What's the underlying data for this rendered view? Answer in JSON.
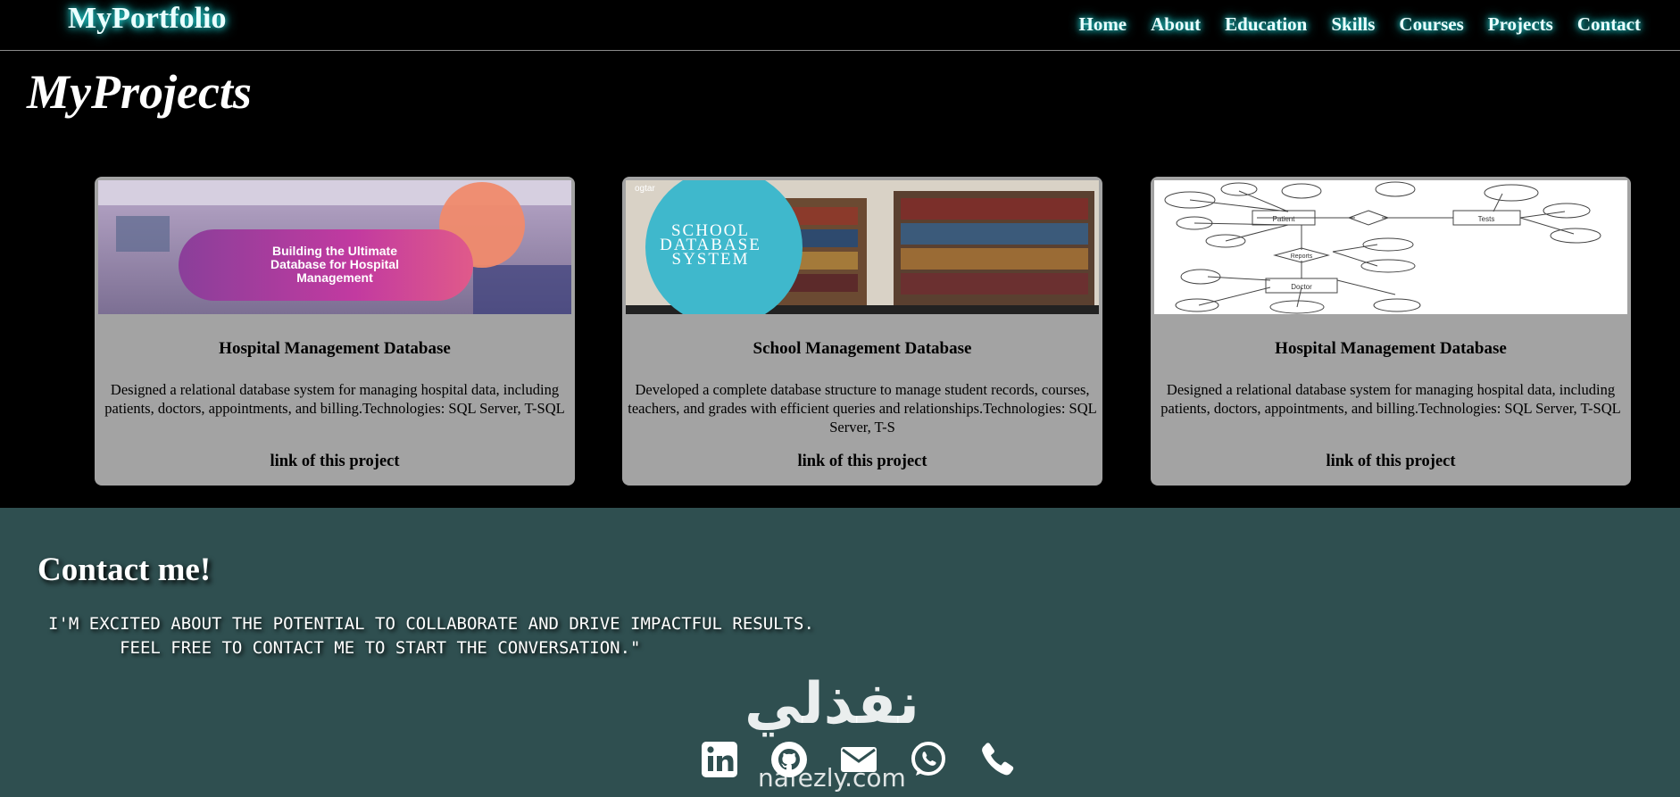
{
  "brand": "MyPortfolio",
  "nav": [
    "Home",
    "About",
    "Education",
    "Skills",
    "Courses",
    "Projects",
    "Contact"
  ],
  "page_title": "MyProjects",
  "projects": [
    {
      "title": "Hospital Management Database",
      "description": "Designed a relational database system for managing hospital data, including patients, doctors, appointments, and billing.Technologies: SQL Server, T-SQL",
      "link": "link of this project",
      "image_text": [
        "Building the Ultimate",
        "Database for Hospital",
        "Management"
      ]
    },
    {
      "title": "School Management Database",
      "description": "Developed a complete database structure to manage student records, courses, teachers, and grades with efficient queries and relationships.Technologies: SQL Server, T-S",
      "link": "link of this project",
      "image_text": [
        "SCHOOL",
        "DATABASE",
        "SYSTEM"
      ],
      "image_logo": "ogtar"
    },
    {
      "title": "Hospital Management Database",
      "description": "Designed a relational database system for managing hospital data, including patients, doctors, appointments, and billing.Technologies: SQL Server, T-SQL",
      "link": "link of this project",
      "image_text": [
        "Patient",
        "Tests",
        "Doctor",
        "Reports"
      ]
    }
  ],
  "contact": {
    "heading": "Contact me!",
    "message": "I'M EXCITED ABOUT THE POTENTIAL TO COLLABORATE AND DRIVE IMPACTFUL RESULTS.\n       FEEL FREE TO CONTACT ME TO START THE CONVERSATION.\"",
    "socials": [
      "linkedin-icon",
      "github-icon",
      "email-icon",
      "whatsapp-icon",
      "phone-icon"
    ]
  },
  "watermark": {
    "arabic": "نفذلي",
    "latin": "nafezly.com"
  },
  "colors": {
    "accent_glow": "#21d6d6",
    "card_bg": "#a3a3a3",
    "contact_bg": "#2f4f50"
  }
}
